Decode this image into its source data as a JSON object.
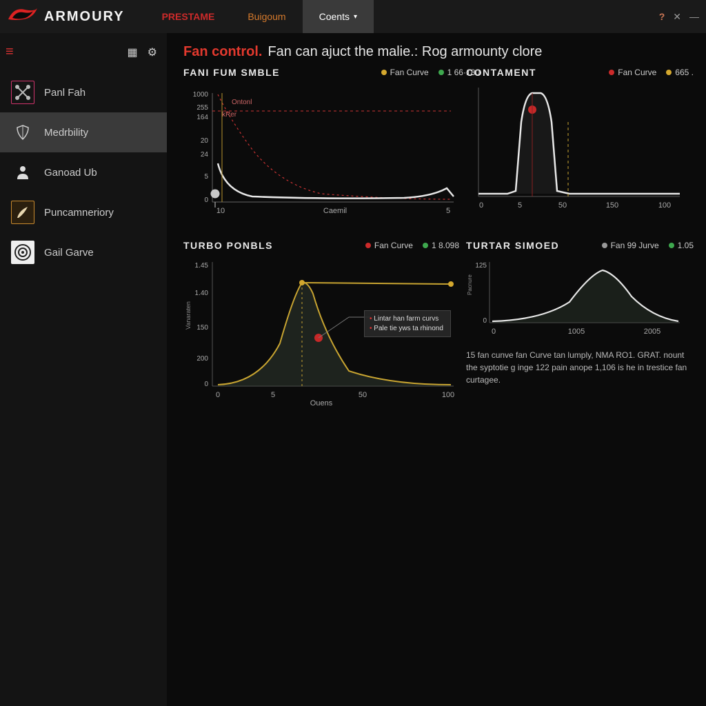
{
  "titlebar": {
    "brand": "ARMOURY",
    "tabs": [
      {
        "label": "PRESTAME",
        "style": "red"
      },
      {
        "label": "Buigoum",
        "style": "orange"
      },
      {
        "label": "Coents",
        "style": "active",
        "has_chevron": true
      }
    ],
    "win": {
      "q": "?",
      "close": "✕",
      "min": "—"
    }
  },
  "sidebar": {
    "hamburger_glyph": "≡",
    "mini": {
      "grid": "▦",
      "gear": "⚙"
    },
    "items": [
      {
        "label": "Panl Fah"
      },
      {
        "label": "Medrbility"
      },
      {
        "label": "Ganoad Ub"
      },
      {
        "label": "Puncamneriory"
      },
      {
        "label": "Gail Garve"
      }
    ]
  },
  "header": {
    "highlight": "Fan control.",
    "subtitle": "Fan can ajuct the malie.: Rog armounty clore"
  },
  "charts": [
    {
      "title": "FANI FUM SMBLE",
      "legend": [
        {
          "cls": "ya",
          "label": "Fan Curve"
        },
        {
          "cls": "gn",
          "label": "1 66·180"
        }
      ],
      "xlabel": "Caemil",
      "badge1": "Ontonl",
      "badge2": "kRer"
    },
    {
      "title": "CONTAMENT",
      "legend": [
        {
          "cls": "rd",
          "label": "Fan Curve"
        },
        {
          "cls": "ya",
          "label": "665 ."
        }
      ]
    },
    {
      "title": "TURBO PONBLS",
      "legend": [
        {
          "cls": "rd",
          "label": "Fan Curve"
        },
        {
          "cls": "gn",
          "label": "1 8.098"
        }
      ],
      "xlabel": "Ouens",
      "ylabel": "Vanaraten",
      "callout": {
        "line1": "Lintar han farm curvs",
        "line2": "Pale tie yws ta rhinond"
      }
    },
    {
      "title": "TURTAR SIMOED",
      "legend": [
        {
          "cls": "gy",
          "label": "Fan 99 Jurve"
        },
        {
          "cls": "gn",
          "label": "1.05"
        }
      ],
      "ylabel": "Pacnure"
    }
  ],
  "description": "15 fan cunve fan Curve tan lumply, NMA RO1. GRAT. nount the syptotie g inge 122 pain anope 1,106 is he in trestice fan curtagee.",
  "chart_data": [
    {
      "type": "line",
      "title": "FANI FUM SMBLE",
      "xlabel": "Caemil",
      "ylabel": "",
      "x_ticks": [
        10,
        5
      ],
      "y_ticks": [
        0,
        5,
        24,
        20,
        164,
        256,
        1000
      ],
      "series": [
        {
          "name": "white",
          "x": [
            10,
            15,
            20,
            25,
            30,
            40,
            60,
            80,
            100
          ],
          "y": [
            60,
            40,
            12,
            8,
            6,
            5,
            5,
            4,
            14
          ]
        },
        {
          "name": "red-dashed",
          "x": [
            10,
            15,
            20,
            25,
            30,
            40,
            60,
            80,
            100
          ],
          "y": [
            1000,
            300,
            120,
            50,
            22,
            10,
            6,
            5,
            5
          ]
        },
        {
          "name": "red-limit",
          "x": [
            10,
            100
          ],
          "y": [
            265,
            265
          ]
        }
      ]
    },
    {
      "type": "line",
      "title": "CONTAMENT",
      "x_ticks": [
        0,
        5,
        50,
        150,
        100
      ],
      "series": [
        {
          "name": "white",
          "x": [
            0,
            10,
            18,
            22,
            26,
            28,
            30,
            32,
            34,
            38,
            44,
            50,
            70,
            100
          ],
          "y": [
            2,
            2,
            2,
            3,
            70,
            95,
            98,
            98,
            95,
            70,
            3,
            2,
            2,
            2
          ]
        },
        {
          "name": "red-point",
          "x": [
            28
          ],
          "y": [
            85
          ]
        },
        {
          "name": "yellow-dashed-vline",
          "x": [
            44,
            44
          ],
          "y": [
            0,
            60
          ]
        }
      ],
      "ylim": [
        0,
        100
      ]
    },
    {
      "type": "area",
      "title": "TURBO PONBLS",
      "xlabel": "Ouens",
      "ylabel": "Vanaraten",
      "x_ticks": [
        0,
        5,
        50,
        100
      ],
      "y_ticks": [
        0,
        200,
        150,
        140,
        145
      ],
      "series": [
        {
          "name": "yellow",
          "x": [
            0,
            10,
            18,
            24,
            28,
            30,
            32,
            34,
            38,
            46,
            60,
            80,
            100
          ],
          "y": [
            2,
            3,
            8,
            40,
            110,
            143,
            145,
            130,
            80,
            20,
            6,
            3,
            2
          ]
        },
        {
          "name": "plateau",
          "x": [
            30,
            100
          ],
          "y": [
            143,
            143
          ]
        },
        {
          "name": "red-point",
          "x": [
            36
          ],
          "y": [
            70
          ]
        }
      ]
    },
    {
      "type": "area",
      "title": "TURTAR SIMOED",
      "ylabel": "Pacnure",
      "x_ticks": [
        0,
        1005,
        2005
      ],
      "y_ticks": [
        0,
        125
      ],
      "series": [
        {
          "name": "white",
          "x": [
            0,
            400,
            800,
            1100,
            1300,
            1450,
            1550,
            1650,
            1800,
            2100,
            2500,
            3000
          ],
          "y": [
            3,
            5,
            10,
            30,
            70,
            110,
            120,
            108,
            65,
            25,
            8,
            3
          ]
        }
      ]
    }
  ]
}
